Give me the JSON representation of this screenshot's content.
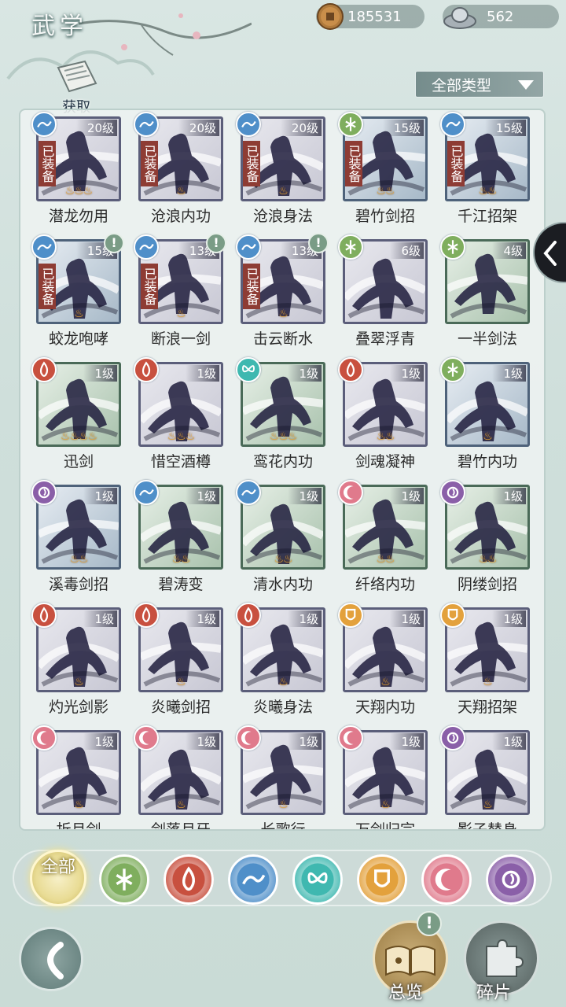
{
  "header": {
    "title": "武学",
    "coins": "185531",
    "coin_icon": "copper-coin-icon",
    "silver": "562",
    "silver_icon": "silver-ingot-icon"
  },
  "acquire": {
    "label": "获取",
    "icon": "scroll-book-icon"
  },
  "filter": {
    "selected": "全部类型"
  },
  "equip_label": "已装备",
  "skills": [
    {
      "name": "潜龙勿用",
      "level": "20级",
      "equipped": true,
      "flames": 3,
      "school": "wave",
      "alert": false,
      "tone": "purple"
    },
    {
      "name": "沧浪内功",
      "level": "20级",
      "equipped": true,
      "flames": 1,
      "school": "wave",
      "alert": false,
      "tone": "purple"
    },
    {
      "name": "沧浪身法",
      "level": "20级",
      "equipped": true,
      "flames": 1,
      "school": "wave",
      "alert": false,
      "tone": "purple"
    },
    {
      "name": "碧竹剑招",
      "level": "15级",
      "equipped": true,
      "flames": 2,
      "school": "bamboo",
      "alert": false,
      "tone": "blue"
    },
    {
      "name": "千江招架",
      "level": "15级",
      "equipped": true,
      "flames": 2,
      "school": "wave",
      "alert": false,
      "tone": "blue"
    },
    {
      "name": "蛟龙咆哮",
      "level": "15级",
      "equipped": true,
      "flames": 1,
      "school": "wave",
      "alert": true,
      "tone": "blue"
    },
    {
      "name": "断浪一剑",
      "level": "13级",
      "equipped": true,
      "flames": 1,
      "school": "wave",
      "alert": true,
      "tone": "purple"
    },
    {
      "name": "击云断水",
      "level": "13级",
      "equipped": true,
      "flames": 1,
      "school": "wave",
      "alert": true,
      "tone": "purple"
    },
    {
      "name": "叠翠浮青",
      "level": "6级",
      "equipped": false,
      "flames": 0,
      "school": "bamboo",
      "alert": false,
      "tone": "purple"
    },
    {
      "name": "一半剑法",
      "level": "4级",
      "equipped": false,
      "flames": 0,
      "school": "bamboo",
      "alert": false,
      "tone": "green"
    },
    {
      "name": "迅剑",
      "level": "1级",
      "equipped": false,
      "flames": 4,
      "school": "flame",
      "alert": false,
      "tone": "green"
    },
    {
      "name": "惜空酒樽",
      "level": "1级",
      "equipped": false,
      "flames": 3,
      "school": "flame",
      "alert": false,
      "tone": "purple"
    },
    {
      "name": "鸾花内功",
      "level": "1级",
      "equipped": false,
      "flames": 3,
      "school": "butterfly",
      "alert": false,
      "tone": "green"
    },
    {
      "name": "剑魂凝神",
      "level": "1级",
      "equipped": false,
      "flames": 2,
      "school": "flame",
      "alert": false,
      "tone": "purple"
    },
    {
      "name": "碧竹内功",
      "level": "1级",
      "equipped": false,
      "flames": 1,
      "school": "bamboo",
      "alert": false,
      "tone": "blue"
    },
    {
      "name": "溪毒剑招",
      "level": "1级",
      "equipped": false,
      "flames": 2,
      "school": "rose",
      "alert": false,
      "tone": "blue"
    },
    {
      "name": "碧涛变",
      "level": "1级",
      "equipped": false,
      "flames": 2,
      "school": "wave",
      "alert": false,
      "tone": "green"
    },
    {
      "name": "清水内功",
      "level": "1级",
      "equipped": false,
      "flames": 2,
      "school": "wave",
      "alert": false,
      "tone": "green"
    },
    {
      "name": "纤络内功",
      "level": "1级",
      "equipped": false,
      "flames": 2,
      "school": "moon",
      "alert": false,
      "tone": "green"
    },
    {
      "name": "阴缕剑招",
      "level": "1级",
      "equipped": false,
      "flames": 2,
      "school": "rose",
      "alert": false,
      "tone": "green"
    },
    {
      "name": "灼光剑影",
      "level": "1级",
      "equipped": false,
      "flames": 1,
      "school": "flame",
      "alert": false,
      "tone": "purple"
    },
    {
      "name": "炎曦剑招",
      "level": "1级",
      "equipped": false,
      "flames": 1,
      "school": "flame",
      "alert": false,
      "tone": "purple"
    },
    {
      "name": "炎曦身法",
      "level": "1级",
      "equipped": false,
      "flames": 1,
      "school": "flame",
      "alert": false,
      "tone": "purple"
    },
    {
      "name": "天翔内功",
      "level": "1级",
      "equipped": false,
      "flames": 1,
      "school": "shield",
      "alert": false,
      "tone": "purple"
    },
    {
      "name": "天翔招架",
      "level": "1级",
      "equipped": false,
      "flames": 1,
      "school": "shield",
      "alert": false,
      "tone": "purple"
    },
    {
      "name": "折月剑",
      "level": "1级",
      "equipped": false,
      "flames": 1,
      "school": "moon",
      "alert": false,
      "tone": "purple"
    },
    {
      "name": "剑落月牙",
      "level": "1级",
      "equipped": false,
      "flames": 1,
      "school": "moon",
      "alert": false,
      "tone": "purple"
    },
    {
      "name": "长歌行",
      "level": "1级",
      "equipped": false,
      "flames": 1,
      "school": "moon",
      "alert": false,
      "tone": "purple"
    },
    {
      "name": "万剑归宗",
      "level": "1级",
      "equipped": false,
      "flames": 1,
      "school": "moon",
      "alert": false,
      "tone": "purple"
    },
    {
      "name": "影子替身",
      "level": "1级",
      "equipped": false,
      "flames": 1,
      "school": "rose",
      "alert": false,
      "tone": "purple"
    }
  ],
  "school_filters": {
    "all_label": "全部",
    "items": [
      "bamboo",
      "flame",
      "wave",
      "butterfly",
      "shield",
      "moon",
      "rose"
    ]
  },
  "school_colors": {
    "bamboo": "#7fae5e",
    "flame": "#c8503f",
    "wave": "#4f8fc9",
    "butterfly": "#3fb8b0",
    "shield": "#e3a13c",
    "moon": "#e07a8c",
    "rose": "#8a5fa8"
  },
  "nav": {
    "overview_label": "总览",
    "fragments_label": "碎片",
    "overview_alert": "!",
    "alert_mark": "!"
  }
}
